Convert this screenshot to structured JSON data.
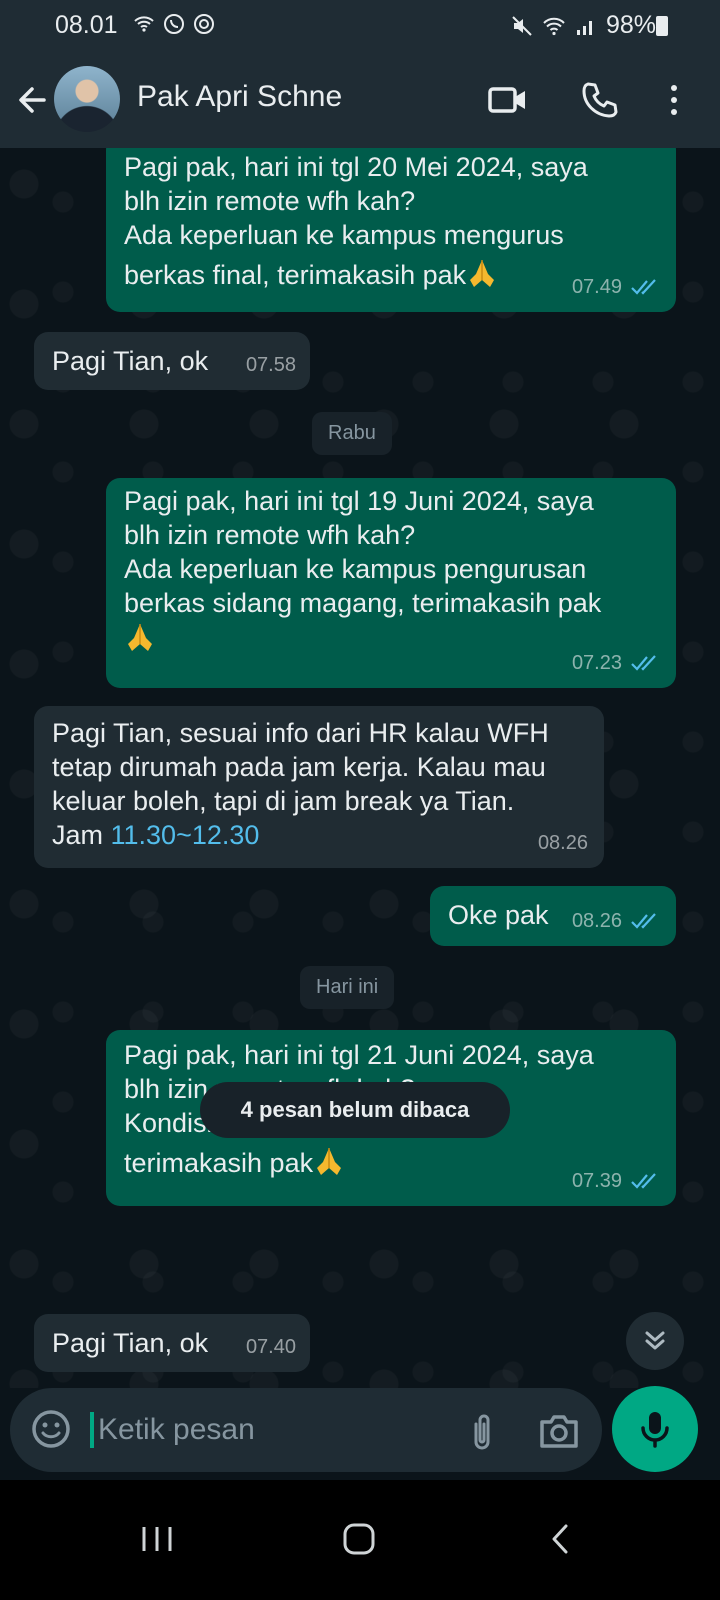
{
  "status_bar": {
    "time": "08.01",
    "battery_percent": "98%",
    "icons": [
      "wifi-calling-icon",
      "whatsapp-icon",
      "app-icon",
      "mute-icon",
      "wifi-icon",
      "signal-icon",
      "battery-icon"
    ]
  },
  "header": {
    "contact_name": "Pak Apri Schne",
    "icons": [
      "back-icon",
      "avatar",
      "video-call-icon",
      "voice-call-icon",
      "more-options-icon"
    ]
  },
  "messages": [
    {
      "direction": "out",
      "lines": [
        "Pagi pak, hari ini tgl 20 Mei 2024, saya",
        "blh izin remote wfh kah?",
        "Ada keperluan ke kampus mengurus",
        "berkas final,  terimakasih pak"
      ],
      "emoji": "folded-hands-icon",
      "time": "07.49",
      "read": true
    },
    {
      "direction": "in",
      "lines": [
        "Pagi Tian, ok"
      ],
      "time": "07.58"
    },
    {
      "direction": "out",
      "lines": [
        "Pagi pak, hari ini tgl 19 Juni 2024, saya",
        "blh izin remote wfh kah?",
        "Ada keperluan ke kampus pengurusan",
        "berkas sidang magang, terimakasih pak"
      ],
      "emoji": "folded-hands-icon",
      "time": "07.23",
      "read": true
    },
    {
      "direction": "in",
      "lines": [
        "Pagi Tian, sesuai info dari HR kalau WFH",
        "tetap dirumah pada jam kerja. Kalau mau",
        "keluar boleh, tapi di jam break ya Tian.",
        "Jam "
      ],
      "link": "11.30~12.30",
      "time": "08.26"
    },
    {
      "direction": "out",
      "lines": [
        "Oke pak"
      ],
      "time": "08.26",
      "read": true
    },
    {
      "direction": "out",
      "lines": [
        "Pagi pak, hari ini tgl 21 Juni 2024, saya",
        "blh izin remote wfh kah?",
        "Kondisi badan kurang sehat,",
        "terimakasih pak"
      ],
      "emoji": "folded-hands-icon",
      "time": "07.39",
      "read": true
    },
    {
      "direction": "in",
      "lines": [
        "Pagi Tian, ok"
      ],
      "time": "07.40"
    }
  ],
  "date_chips": [
    "Rabu",
    "Hari ini"
  ],
  "unread_banner": "4 pesan belum dibaca",
  "composer": {
    "placeholder": "Ketik pesan"
  },
  "colors": {
    "background": "#0b141a",
    "header": "#1f2c34",
    "outgoing_bubble": "#005c4b",
    "incoming_bubble": "#202c33",
    "accent": "#00a884",
    "read_tick": "#53bdeb"
  }
}
